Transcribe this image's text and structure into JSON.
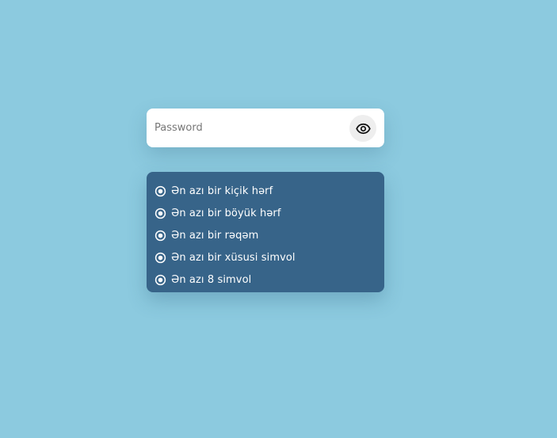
{
  "password_field": {
    "placeholder": "Password",
    "value": "",
    "toggle_icon": "eye-icon"
  },
  "requirements": {
    "icon": "radio-dot-icon",
    "items": [
      {
        "label": "Ən azı bir kiçik hərf"
      },
      {
        "label": "Ən azı bir böyük hərf"
      },
      {
        "label": "Ən azı bir rəqəm"
      },
      {
        "label": "Ən azı bir xüsusi simvol"
      },
      {
        "label": "Ən azı 8 simvol"
      }
    ]
  },
  "colors": {
    "background": "#8ccadf",
    "panel": "#376489",
    "input_background": "#ffffff",
    "toggle_background": "#eeeeee",
    "text_light": "#ffffff"
  }
}
